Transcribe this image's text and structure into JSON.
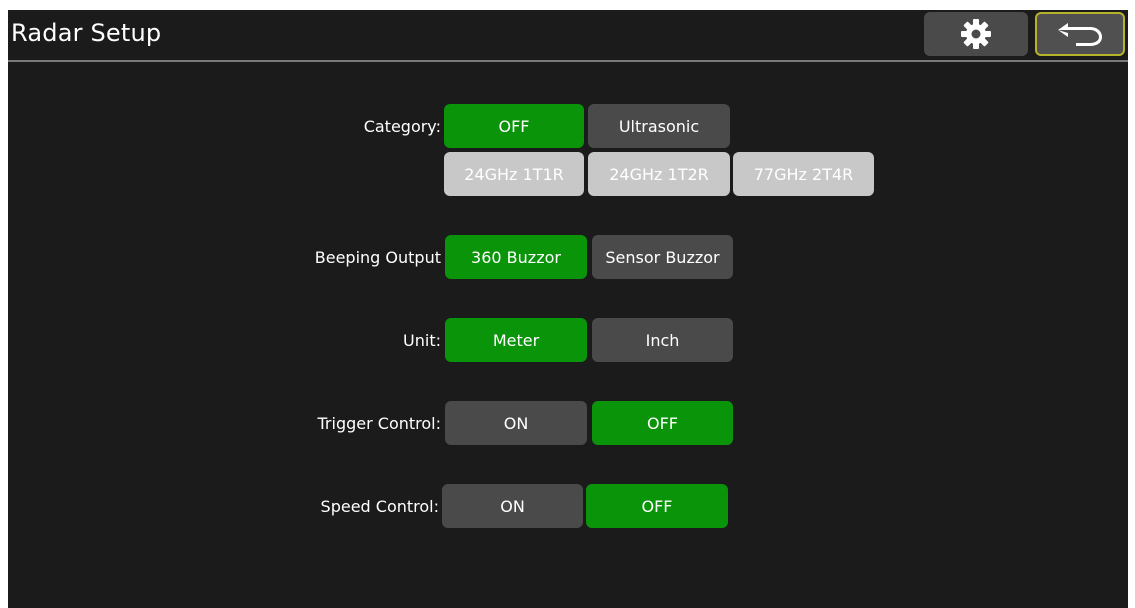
{
  "header": {
    "title": "Radar Setup",
    "settings_icon": "gear-icon",
    "back_icon": "back-arrow-icon",
    "accent_border": "#b5b32a"
  },
  "colors": {
    "background": "#1b1b1b",
    "selected": "#0a940a",
    "unselected": "#4a4a4a",
    "light_option": "#c8c8c8"
  },
  "settings": {
    "category": {
      "label": "Category:",
      "options": [
        "OFF",
        "Ultrasonic",
        "24GHz 1T1R",
        "24GHz 1T2R",
        "77GHz 2T4R"
      ],
      "selected": "OFF"
    },
    "beeping_output": {
      "label": "Beeping Output",
      "options": [
        "360 Buzzor",
        "Sensor Buzzor"
      ],
      "selected": "360 Buzzor"
    },
    "unit": {
      "label": "Unit:",
      "options": [
        "Meter",
        "Inch"
      ],
      "selected": "Meter"
    },
    "trigger_control": {
      "label": "Trigger Control:",
      "options": [
        "ON",
        "OFF"
      ],
      "selected": "OFF"
    },
    "speed_control": {
      "label": "Speed Control:",
      "options": [
        "ON",
        "OFF"
      ],
      "selected": "OFF"
    }
  }
}
